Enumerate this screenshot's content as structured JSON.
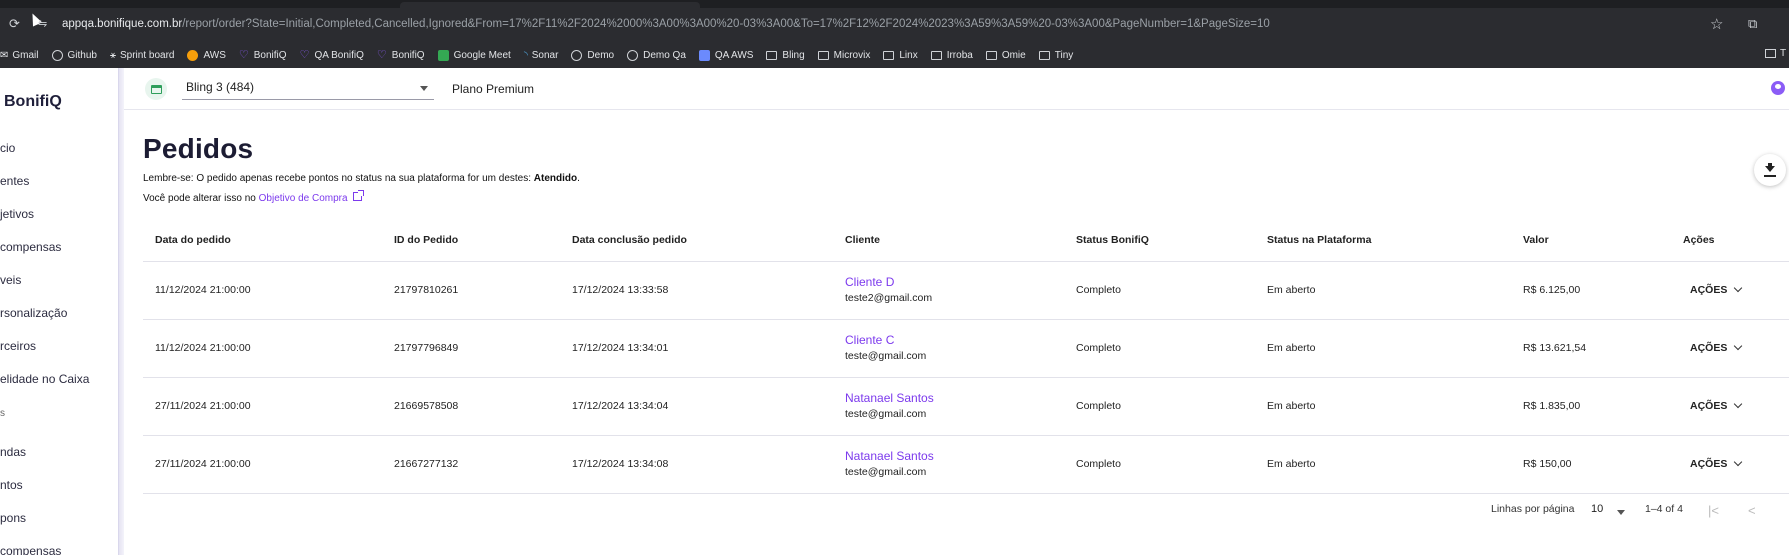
{
  "browser": {
    "url_host": "appqa.bonifique.com.br",
    "url_path": "/report/order?State=Initial,Completed,Cancelled,Ignored&From=17%2F11%2F2024%2000%3A00%3A00%20-03%3A00&To=17%2F12%2F2024%2023%3A59%3A59%20-03%3A00&PageNumber=1&PageSize=10",
    "bookmarks": [
      {
        "label": "Gmail",
        "icon": "gmail-icon"
      },
      {
        "label": "Github",
        "icon": "github-icon"
      },
      {
        "label": "Sprint board",
        "icon": "sprint-icon"
      },
      {
        "label": "AWS",
        "icon": "aws-icon"
      },
      {
        "label": "BonifiQ",
        "icon": "bonifiq-icon"
      },
      {
        "label": "QA BonifiQ",
        "icon": "bonifiq-icon"
      },
      {
        "label": "BonifiQ",
        "icon": "bonifiq-icon"
      },
      {
        "label": "Google Meet",
        "icon": "meet-icon"
      },
      {
        "label": "Sonar",
        "icon": "sonar-icon"
      },
      {
        "label": "Demo",
        "icon": "globe-icon"
      },
      {
        "label": "Demo Qa",
        "icon": "globe-icon"
      },
      {
        "label": "QA AWS",
        "icon": "aws-icon"
      },
      {
        "label": "Bling",
        "icon": "folder-icon"
      },
      {
        "label": "Microvix",
        "icon": "folder-icon"
      },
      {
        "label": "Linx",
        "icon": "folder-icon"
      },
      {
        "label": "Irroba",
        "icon": "folder-icon"
      },
      {
        "label": "Omie",
        "icon": "folder-icon"
      },
      {
        "label": "Tiny",
        "icon": "folder-icon"
      }
    ],
    "bookmarks_overflow": "T"
  },
  "sidebar": {
    "brand": "BonifiQ",
    "items": [
      {
        "label": "cio",
        "top": 0
      },
      {
        "label": "entes"
      },
      {
        "label": "jetivos"
      },
      {
        "label": "compensas"
      },
      {
        "label": "veis"
      },
      {
        "label": "rsonalização"
      },
      {
        "label": "rceiros"
      },
      {
        "label": "elidade no Caixa"
      }
    ],
    "section": "s",
    "items2": [
      {
        "label": "ndas"
      },
      {
        "label": "ntos"
      },
      {
        "label": "pons"
      },
      {
        "label": "compensas"
      }
    ]
  },
  "header": {
    "store": "Bling 3 (484)",
    "plan": "Plano Premium"
  },
  "page": {
    "title": "Pedidos",
    "note1_prefix": "Lembre-se: O pedido apenas recebe pontos no status na sua plataforma for um destes: ",
    "note1_bold": "Atendido",
    "note1_suffix": ".",
    "note2_prefix": "Você pode alterar isso no ",
    "note2_link": "Objetivo de Compra"
  },
  "table": {
    "headers": [
      "Data do pedido",
      "ID do Pedido",
      "Data conclusão pedido",
      "Cliente",
      "Status BonifiQ",
      "Status na Plataforma",
      "Valor",
      "Ações"
    ],
    "rows": [
      {
        "date": "11/12/2024 21:00:00",
        "id": "21797810261",
        "done": "17/12/2024 13:33:58",
        "client": "Cliente D",
        "email": "teste2@gmail.com",
        "status": "Completo",
        "platform": "Em aberto",
        "value": "R$ 6.125,00",
        "action": "AÇÕES"
      },
      {
        "date": "11/12/2024 21:00:00",
        "id": "21797796849",
        "done": "17/12/2024 13:34:01",
        "client": "Cliente C",
        "email": "teste@gmail.com",
        "status": "Completo",
        "platform": "Em aberto",
        "value": "R$ 13.621,54",
        "action": "AÇÕES"
      },
      {
        "date": "27/11/2024 21:00:00",
        "id": "21669578508",
        "done": "17/12/2024 13:34:04",
        "client": "Natanael Santos",
        "email": "teste@gmail.com",
        "status": "Completo",
        "platform": "Em aberto",
        "value": "R$ 1.835,00",
        "action": "AÇÕES"
      },
      {
        "date": "27/11/2024 21:00:00",
        "id": "21667277132",
        "done": "17/12/2024 13:34:08",
        "client": "Natanael Santos",
        "email": "teste@gmail.com",
        "status": "Completo",
        "platform": "Em aberto",
        "value": "R$ 150,00",
        "action": "AÇÕES"
      }
    ]
  },
  "pagination": {
    "rows_label": "Linhas por página",
    "rows_value": "10",
    "range": "1–4 of 4",
    "first": "|<",
    "prev": "<"
  },
  "colors": {
    "accent": "#7c3aed",
    "chrome": "#2b2c30"
  }
}
